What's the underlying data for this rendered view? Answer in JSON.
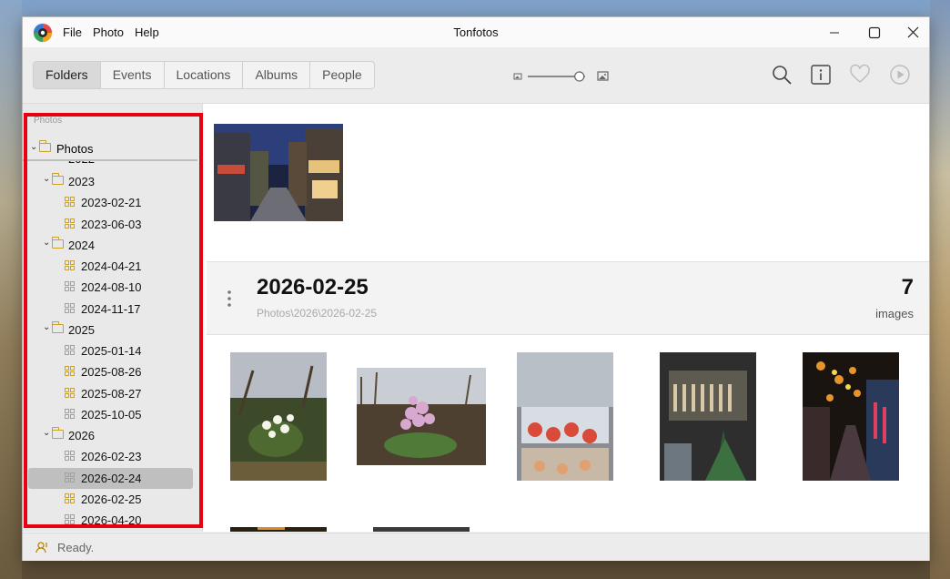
{
  "app": {
    "title": "Tonfotos"
  },
  "menu": [
    "File",
    "Photo",
    "Help"
  ],
  "tabs": [
    {
      "label": "Folders",
      "active": true
    },
    {
      "label": "Events",
      "active": false
    },
    {
      "label": "Locations",
      "active": false
    },
    {
      "label": "Albums",
      "active": false
    },
    {
      "label": "People",
      "active": false
    }
  ],
  "zoom": {
    "value_fraction": 0.9
  },
  "toolbar_icons": [
    "search-icon",
    "info-icon",
    "heart-icon",
    "play-icon"
  ],
  "sidebar": {
    "header": "Photos",
    "root": "Photos",
    "partial_year": "2022",
    "tree": [
      {
        "label": "2023",
        "type": "year"
      },
      {
        "label": "2023-02-21",
        "type": "day"
      },
      {
        "label": "2023-06-03",
        "type": "day"
      },
      {
        "label": "2024",
        "type": "year"
      },
      {
        "label": "2024-04-21",
        "type": "day"
      },
      {
        "label": "2024-08-10",
        "type": "day"
      },
      {
        "label": "2024-11-17",
        "type": "day"
      },
      {
        "label": "2025",
        "type": "year"
      },
      {
        "label": "2025-01-14",
        "type": "day"
      },
      {
        "label": "2025-08-26",
        "type": "day"
      },
      {
        "label": "2025-08-27",
        "type": "day"
      },
      {
        "label": "2025-10-05",
        "type": "day"
      },
      {
        "label": "2026",
        "type": "year"
      },
      {
        "label": "2026-02-23",
        "type": "day"
      },
      {
        "label": "2026-02-24",
        "type": "day",
        "selected": true
      },
      {
        "label": "2026-02-25",
        "type": "day"
      },
      {
        "label": "2026-04-20",
        "type": "day"
      }
    ]
  },
  "group": {
    "date": "2026-02-25",
    "path": "Photos\\2026\\2026-02-25",
    "count": "7",
    "count_label": "images"
  },
  "status": {
    "text": "Ready."
  },
  "colors": {
    "highlight": "#e60012",
    "folder": "#c9a227",
    "selected_row": "#bfbfbf"
  }
}
